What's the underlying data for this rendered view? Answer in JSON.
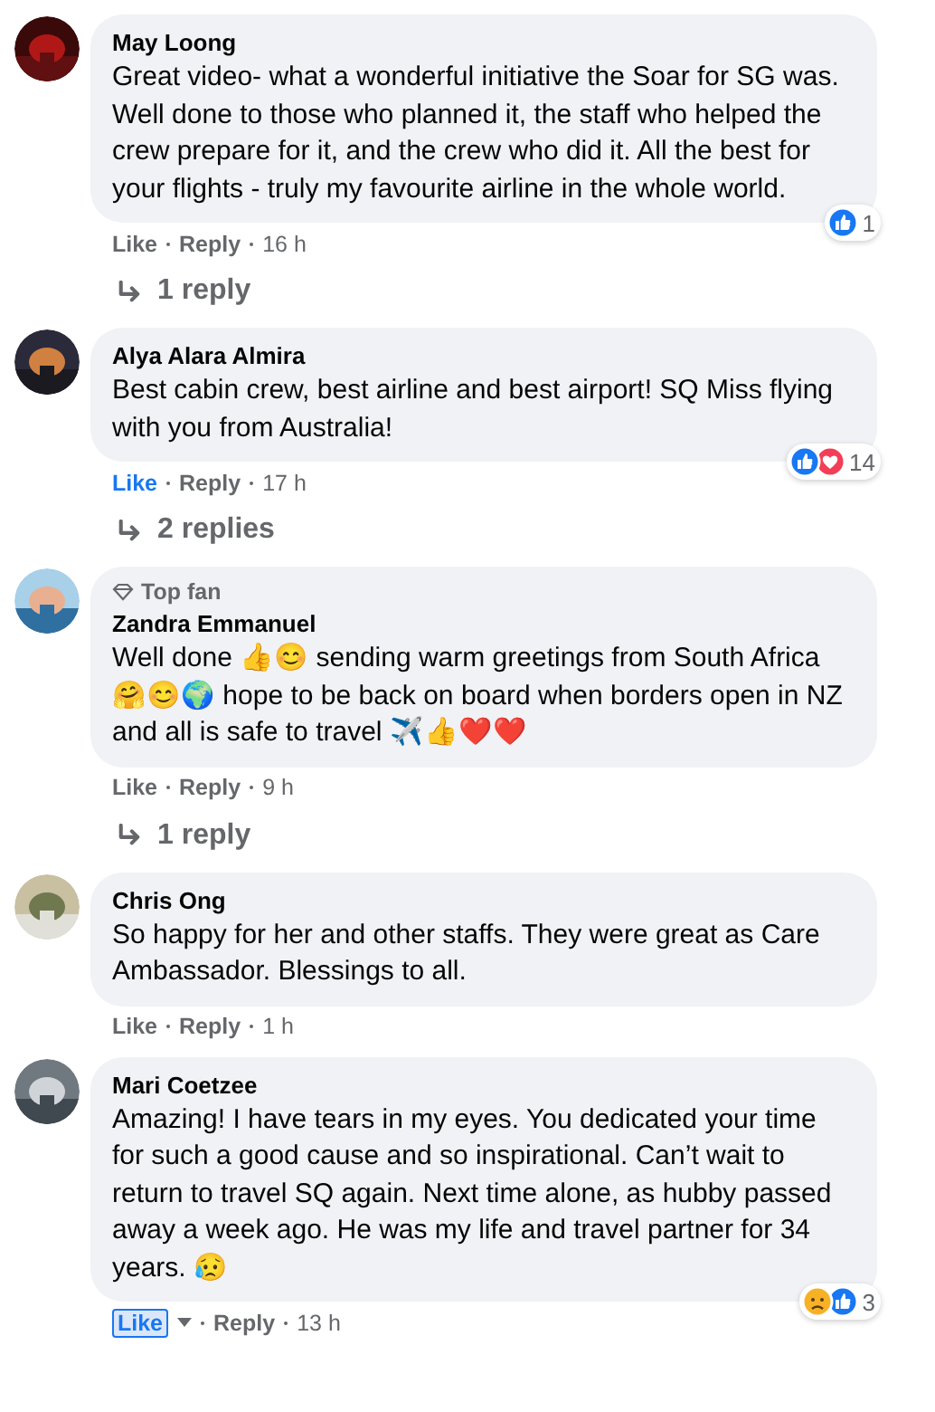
{
  "comments": [
    {
      "author": "May Loong",
      "body": "Great video- what a wonderful initiative the Soar for SG was. Well done to those who planned it, the staff who helped the crew prepare for it, and the crew who did it. All the best for your flights - truly my favourite airline in the whole world.",
      "like_label": "Like",
      "liked": false,
      "like_menu": false,
      "reply_label": "Reply",
      "time": "16 h",
      "reactions": [
        {
          "kind": "like"
        }
      ],
      "reaction_count": "1",
      "replies": "1 reply"
    },
    {
      "author": "Alya Alara Almira",
      "body": "Best cabin crew, best airline and best airport! SQ Miss flying with you from Australia!",
      "like_label": "Like",
      "liked": true,
      "like_menu": false,
      "reply_label": "Reply",
      "time": "17 h",
      "reactions": [
        {
          "kind": "like"
        },
        {
          "kind": "love"
        }
      ],
      "reaction_count": "14",
      "replies": "2 replies"
    },
    {
      "author": "Zandra Emmanuel",
      "badge": "Top fan",
      "body": "Well done 👍😊 sending warm greetings from South Africa 🤗😊🌍 hope to be back on board when borders open in NZ and all is safe to travel ✈️👍❤️❤️",
      "like_label": "Like",
      "liked": false,
      "like_menu": false,
      "reply_label": "Reply",
      "time": "9 h",
      "replies": "1 reply"
    },
    {
      "author": "Chris Ong",
      "body": "So happy for her and other staffs. They were great as Care Ambassador. Blessings to all.",
      "like_label": "Like",
      "liked": false,
      "like_menu": false,
      "reply_label": "Reply",
      "time": "1 h"
    },
    {
      "author": "Mari Coetzee",
      "body": "Amazing! I have tears in my eyes. You dedicated your time for such a good cause and so inspirational. Can’t wait to return to travel SQ again. Next time alone, as hubby passed away a week ago. He was my life and travel partner for 34 years. 😥",
      "like_label": "Like",
      "liked": true,
      "like_menu": true,
      "reply_label": "Reply",
      "time": "13 h",
      "reactions": [
        {
          "kind": "sad"
        },
        {
          "kind": "like"
        }
      ],
      "reaction_count": "3"
    }
  ]
}
